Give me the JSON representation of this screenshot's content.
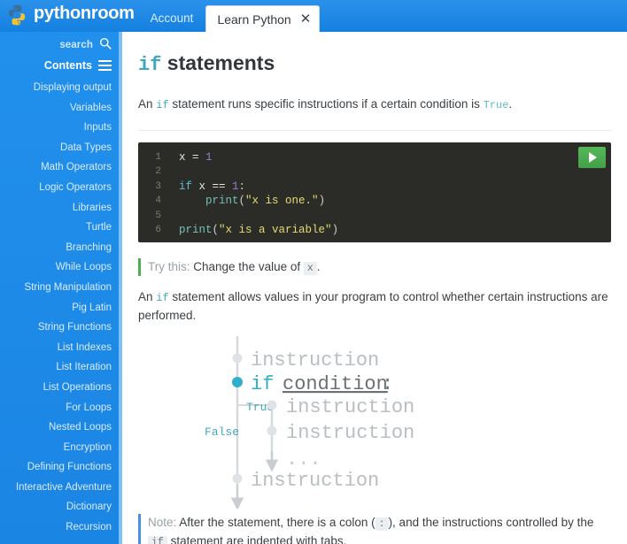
{
  "topbar": {
    "brand": "pythonroom",
    "logo_icon": "python-logo-icon",
    "account_label": "Account",
    "tab_label": "Learn Python",
    "tab_close_glyph": "✕"
  },
  "sidebar": {
    "search_label": "search",
    "search_icon": "search-icon",
    "contents_label": "Contents",
    "menu_icon": "hamburger-menu-icon",
    "items": [
      {
        "label": "Displaying output"
      },
      {
        "label": "Variables"
      },
      {
        "label": "Inputs"
      },
      {
        "label": "Data Types"
      },
      {
        "label": "Math Operators"
      },
      {
        "label": "Logic Operators"
      },
      {
        "label": "Libraries"
      },
      {
        "label": "Turtle"
      },
      {
        "label": "Branching"
      },
      {
        "label": "While Loops"
      },
      {
        "label": "String Manipulation"
      },
      {
        "label": "Pig Latin"
      },
      {
        "label": "String Functions"
      },
      {
        "label": "List Indexes"
      },
      {
        "label": "List Iteration"
      },
      {
        "label": "List Operations"
      },
      {
        "label": "For Loops"
      },
      {
        "label": "Nested Loops"
      },
      {
        "label": "Encryption"
      },
      {
        "label": "Defining Functions"
      },
      {
        "label": "Interactive Adventure"
      },
      {
        "label": "Dictionary"
      },
      {
        "label": "Recursion"
      }
    ]
  },
  "main": {
    "title_keyword": "if",
    "title_rest": " statements",
    "intro": {
      "part1": "An ",
      "kw": "if",
      "part2": " statement runs specific instructions if a certain condition is ",
      "true_word": "True",
      "part3": "."
    },
    "code": {
      "run_button_icon": "play-icon",
      "lines": [
        {
          "num": "1",
          "tokens": [
            {
              "t": "x ",
              "c": "t-op"
            },
            {
              "t": "= ",
              "c": "t-op"
            },
            {
              "t": "1",
              "c": "t-num"
            }
          ]
        },
        {
          "num": "2",
          "tokens": []
        },
        {
          "num": "3",
          "tokens": [
            {
              "t": "if",
              "c": "t-kw"
            },
            {
              "t": " x == ",
              "c": "t-op"
            },
            {
              "t": "1",
              "c": "t-num"
            },
            {
              "t": ":",
              "c": "t-punc"
            }
          ]
        },
        {
          "num": "4",
          "tokens": [
            {
              "t": "    ",
              "c": "t-op"
            },
            {
              "t": "print",
              "c": "t-fn"
            },
            {
              "t": "(",
              "c": "t-punc"
            },
            {
              "t": "\"x is one.\"",
              "c": "t-str"
            },
            {
              "t": ")",
              "c": "t-punc"
            }
          ]
        },
        {
          "num": "5",
          "tokens": []
        },
        {
          "num": "6",
          "tokens": [
            {
              "t": "print",
              "c": "t-fn"
            },
            {
              "t": "(",
              "c": "t-punc"
            },
            {
              "t": "\"x is a variable\"",
              "c": "t-str"
            },
            {
              "t": ")",
              "c": "t-punc"
            }
          ]
        }
      ]
    },
    "try_callout": {
      "lead": "Try this:",
      "text_before": " Change the value of ",
      "code": "x",
      "text_after": "."
    },
    "paragraph2": {
      "part1": "An ",
      "kw": "if",
      "part2": " statement allows values in your program to control whether certain instructions are performed."
    },
    "note_callout": {
      "lead": "Note:",
      "text1": " After the statement, there is a colon (",
      "code1": ":",
      "text2": "), and the instructions controlled by the ",
      "code2": "if",
      "text3": " statement are indented with tabs."
    }
  },
  "diagram": {
    "type": "flowchart",
    "nodes": [
      {
        "id": "n1",
        "label": "instruction",
        "style": "gray",
        "dot": "hollow-gray"
      },
      {
        "id": "n2",
        "label_kw": "if",
        "label_cond": "condition",
        "label_colon": ":",
        "style": "teal",
        "dot": "filled-teal"
      },
      {
        "id": "n3",
        "label": "instruction",
        "style": "gray",
        "dot": "hollow-gray",
        "branch": "true"
      },
      {
        "id": "n4",
        "label": "instruction",
        "style": "gray",
        "dot": "hollow-gray",
        "branch": "true"
      },
      {
        "id": "n5",
        "label": "...",
        "style": "gray",
        "dot": "none",
        "branch": "true"
      },
      {
        "id": "n6",
        "label": "instruction",
        "style": "gray",
        "dot": "hollow-gray"
      }
    ],
    "edge_labels": [
      {
        "text": "True",
        "color": "#3fa8bd"
      },
      {
        "text": "False",
        "color": "#3fa8bd"
      }
    ]
  },
  "colors": {
    "brand_blue": "#1e8ae8",
    "sidebar_edge": "#7fc0f2",
    "accent_teal": "#3fa8bd",
    "run_green": "#4caf50",
    "note_blue": "#4a90e2",
    "code_bg": "#2b2b27"
  }
}
